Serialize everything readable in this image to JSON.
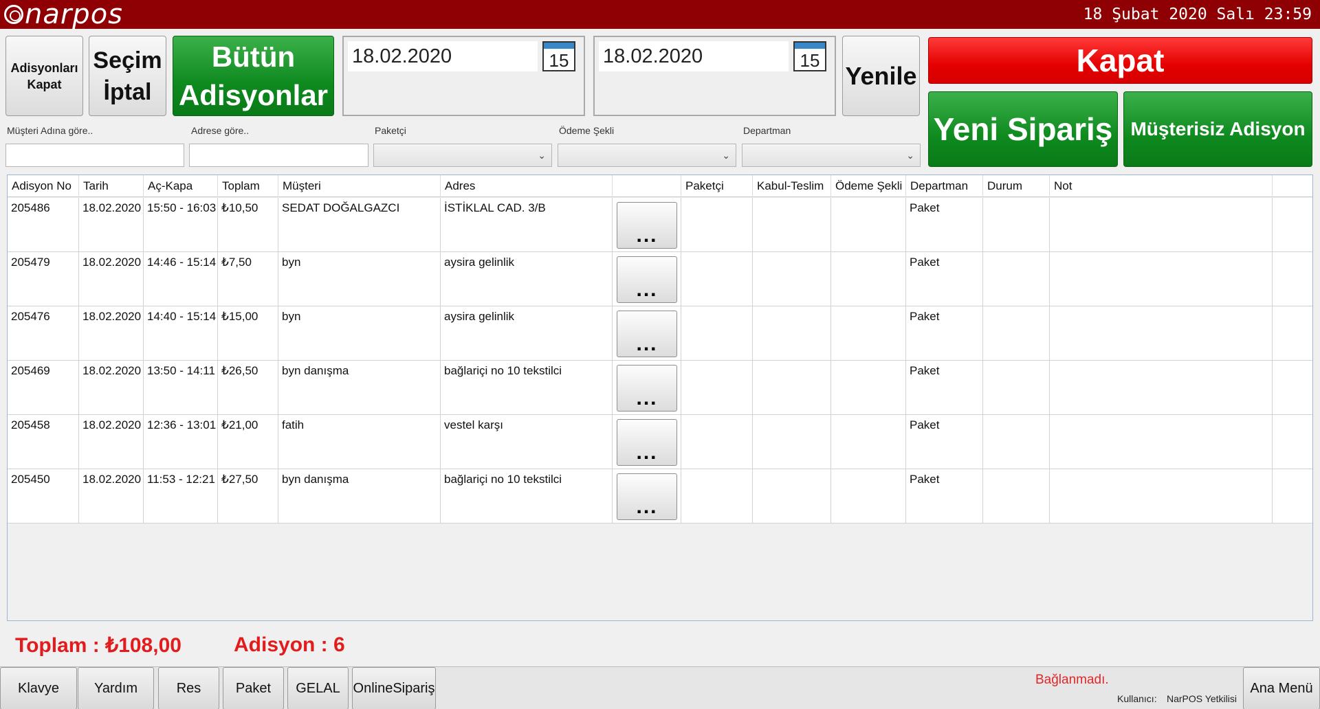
{
  "header": {
    "logo_text": "narpos",
    "datetime": "18 Şubat 2020 Salı 23:59"
  },
  "toolbar": {
    "close_orders_label_1": "Adisyonları",
    "close_orders_label_2": "Kapat",
    "cancel_selection_1": "Seçim",
    "cancel_selection_2": "İptal",
    "all_orders_1": "Bütün",
    "all_orders_2": "Adisyonlar",
    "date_from": "18.02.2020",
    "date_to": "18.02.2020",
    "calendar_day": "15",
    "refresh_label": "Yenile",
    "close_label": "Kapat",
    "new_order_label": "Yeni Sipariş",
    "no_customer_label": "Müşterisiz Adisyon"
  },
  "filters": {
    "customer_label": "Müşteri Adına göre..",
    "customer_value": "",
    "address_label": "Adrese göre..",
    "address_value": "",
    "courier_label": "Paketçi",
    "courier_value": "",
    "payment_label": "Ödeme Şekli",
    "payment_value": "",
    "department_label": "Departman",
    "department_value": ""
  },
  "grid": {
    "columns": [
      "Adisyon No",
      "Tarih",
      "Aç-Kapa",
      "Toplam",
      "Müşteri",
      "Adres",
      "",
      "Paketçi",
      "Kabul-Teslim",
      "Ödeme Şekli",
      "Departman",
      "Durum",
      "Not",
      ""
    ],
    "more_label": "...",
    "rows": [
      {
        "no": "205486",
        "date": "18.02.2020",
        "time": "15:50 - 16:03",
        "total": "₺10,50",
        "customer": "SEDAT DOĞALGAZCI",
        "address": "İSTİKLAL CAD. 3/B",
        "courier": "",
        "accept": "",
        "payment": "",
        "dept": "Paket",
        "status": "",
        "note": ""
      },
      {
        "no": "205479",
        "date": "18.02.2020",
        "time": "14:46 - 15:14",
        "total": "₺7,50",
        "customer": "byn",
        "address": "aysira gelinlik",
        "courier": "",
        "accept": "",
        "payment": "",
        "dept": "Paket",
        "status": "",
        "note": ""
      },
      {
        "no": "205476",
        "date": "18.02.2020",
        "time": "14:40 - 15:14",
        "total": "₺15,00",
        "customer": "byn",
        "address": "aysira gelinlik",
        "courier": "",
        "accept": "",
        "payment": "",
        "dept": "Paket",
        "status": "",
        "note": ""
      },
      {
        "no": "205469",
        "date": "18.02.2020",
        "time": "13:50 - 14:11",
        "total": "₺26,50",
        "customer": "byn danışma",
        "address": "bağlariçi no 10 tekstilci",
        "courier": "",
        "accept": "",
        "payment": "",
        "dept": "Paket",
        "status": "",
        "note": ""
      },
      {
        "no": "205458",
        "date": "18.02.2020",
        "time": "12:36 - 13:01",
        "total": "₺21,00",
        "customer": "fatih",
        "address": "vestel karşı",
        "courier": "",
        "accept": "",
        "payment": "",
        "dept": "Paket",
        "status": "",
        "note": ""
      },
      {
        "no": "205450",
        "date": "18.02.2020",
        "time": "11:53 - 12:21",
        "total": "₺27,50",
        "customer": "byn danışma",
        "address": "bağlariçi no 10 tekstilci",
        "courier": "",
        "accept": "",
        "payment": "",
        "dept": "Paket",
        "status": "",
        "note": ""
      }
    ]
  },
  "summary": {
    "total": "Toplam : ₺108,00",
    "count": "Adisyon : 6"
  },
  "bottombar": {
    "keyboard": "Klavye",
    "help": "Yardım",
    "res": "Res",
    "package": "Paket",
    "gelal": "GELAL",
    "online": "OnlineSipariş",
    "status": "Bağlanmadı.",
    "user_label": "Kullanıcı:",
    "user_value": "NarPOS Yetkilisi",
    "main_menu": "Ana Menü"
  },
  "colors": {
    "header_bg": "#8f0004",
    "green": "#0e8a1f",
    "red": "#e40000",
    "summary_red": "#e21c1c"
  }
}
